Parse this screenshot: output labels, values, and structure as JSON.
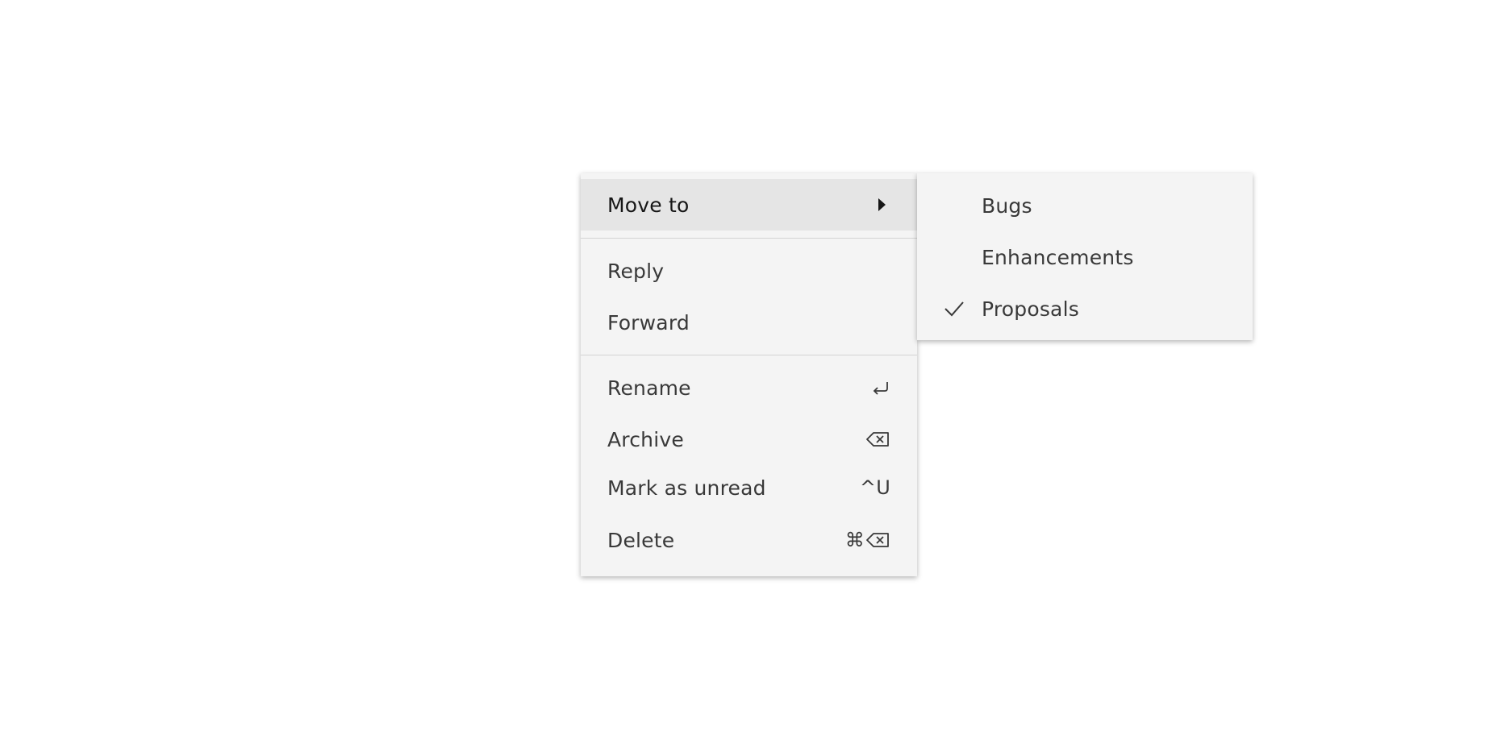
{
  "main_menu": {
    "items": [
      {
        "label": "Move to",
        "has_submenu": true,
        "active": true
      },
      {
        "label": "Reply"
      },
      {
        "label": "Forward"
      },
      {
        "label": "Rename",
        "shortcut": "↩"
      },
      {
        "label": "Archive",
        "shortcut": "⌫"
      },
      {
        "label": "Mark as unread",
        "shortcut": "^U"
      },
      {
        "label": "Delete",
        "shortcut": "⌘⌫"
      }
    ]
  },
  "submenu": {
    "items": [
      {
        "label": "Bugs",
        "checked": false
      },
      {
        "label": "Enhancements",
        "checked": false
      },
      {
        "label": "Proposals",
        "checked": true
      }
    ]
  },
  "icons": {
    "submenu_caret": "caret-right-icon",
    "checkmark": "checkmark-icon"
  },
  "colors": {
    "menu_bg": "#f4f4f4",
    "active_bg": "#e5e5e5",
    "text": "#393939",
    "text_active": "#161616",
    "divider": "#d3d3d3"
  }
}
